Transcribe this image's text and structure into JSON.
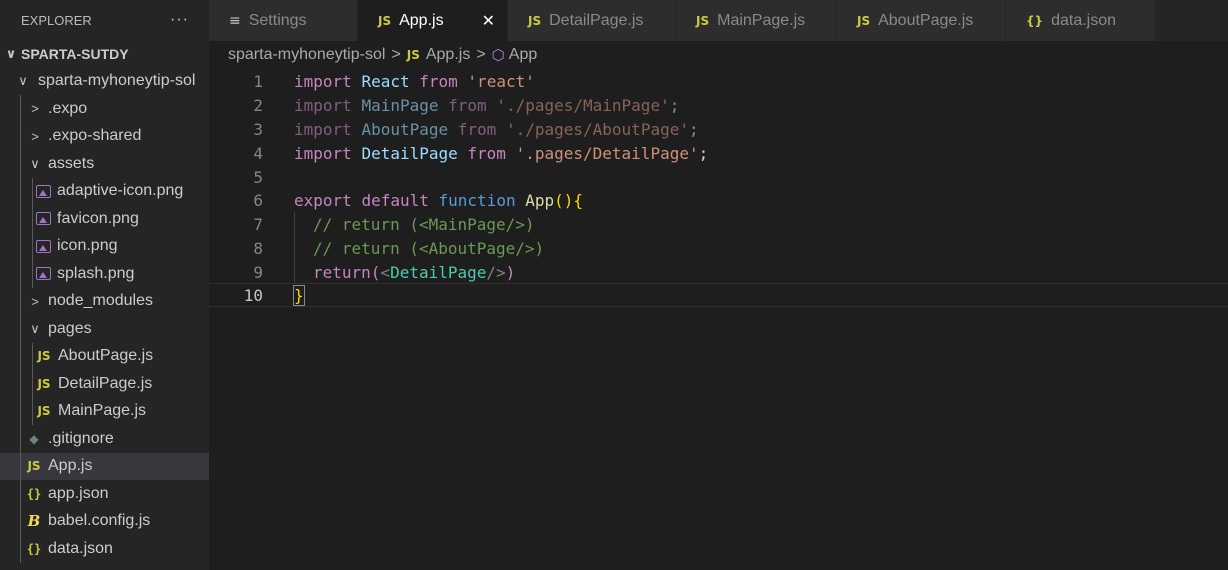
{
  "explorer": {
    "title": "EXPLORER",
    "more": "···",
    "root": "SPARTA-SUTDY",
    "items": [
      {
        "label": "sparta-myhoneytip-sol",
        "type": "folder-open"
      },
      {
        "label": ".expo",
        "type": "folder"
      },
      {
        "label": ".expo-shared",
        "type": "folder"
      },
      {
        "label": "assets",
        "type": "folder-open"
      },
      {
        "label": "adaptive-icon.png",
        "type": "image"
      },
      {
        "label": "favicon.png",
        "type": "image"
      },
      {
        "label": "icon.png",
        "type": "image"
      },
      {
        "label": "splash.png",
        "type": "image"
      },
      {
        "label": "node_modules",
        "type": "folder"
      },
      {
        "label": "pages",
        "type": "folder-open"
      },
      {
        "label": "AboutPage.js",
        "type": "js"
      },
      {
        "label": "DetailPage.js",
        "type": "js"
      },
      {
        "label": "MainPage.js",
        "type": "js"
      },
      {
        "label": ".gitignore",
        "type": "git"
      },
      {
        "label": "App.js",
        "type": "js"
      },
      {
        "label": "app.json",
        "type": "json"
      },
      {
        "label": "babel.config.js",
        "type": "babel"
      },
      {
        "label": "data.json",
        "type": "json"
      }
    ]
  },
  "icons": {
    "js": "JS",
    "json": "{}",
    "chevron_right": ">",
    "chevron_down": "∨",
    "close": "✕",
    "settings": "≡",
    "cube": "⬡"
  },
  "tabs": [
    {
      "label": "Settings",
      "icon": "settings"
    },
    {
      "label": "App.js",
      "icon": "js",
      "active": true
    },
    {
      "label": "DetailPage.js",
      "icon": "js"
    },
    {
      "label": "MainPage.js",
      "icon": "js"
    },
    {
      "label": "AboutPage.js",
      "icon": "js"
    },
    {
      "label": "data.json",
      "icon": "json"
    }
  ],
  "breadcrumb": {
    "folder": "sparta-myhoneytip-sol",
    "file": "App.js",
    "symbol": "App"
  },
  "editor": {
    "line_numbers": [
      "1",
      "2",
      "3",
      "4",
      "5",
      "6",
      "7",
      "8",
      "9",
      "10"
    ],
    "lines": {
      "l1": {
        "kw": "import",
        "id": "React",
        "from": "from",
        "str": "'react'"
      },
      "l2": {
        "kw": "import",
        "id": "MainPage",
        "from": "from",
        "str": "'./pages/MainPage'",
        "end": ";"
      },
      "l3": {
        "kw": "import",
        "id": "AboutPage",
        "from": "from",
        "str": "'./pages/AboutPage'",
        "end": ";"
      },
      "l4": {
        "kw": "import",
        "id": "DetailPage",
        "from": "from",
        "str": "'.pages/DetailPage'",
        "end": ";"
      },
      "l6": {
        "kw1": "export",
        "kw2": "default",
        "kw3": "function",
        "fn": "App",
        "paren": "()",
        "brace": "{"
      },
      "l7": {
        "comment": "// return (<MainPage/>)"
      },
      "l8": {
        "comment": "// return (<AboutPage/>)"
      },
      "l9": {
        "kw": "return",
        "open": "(",
        "lt": "<",
        "cmp": "DetailPage",
        "close": "/>",
        "cp": ")"
      },
      "l10": {
        "brace": "}"
      }
    }
  }
}
